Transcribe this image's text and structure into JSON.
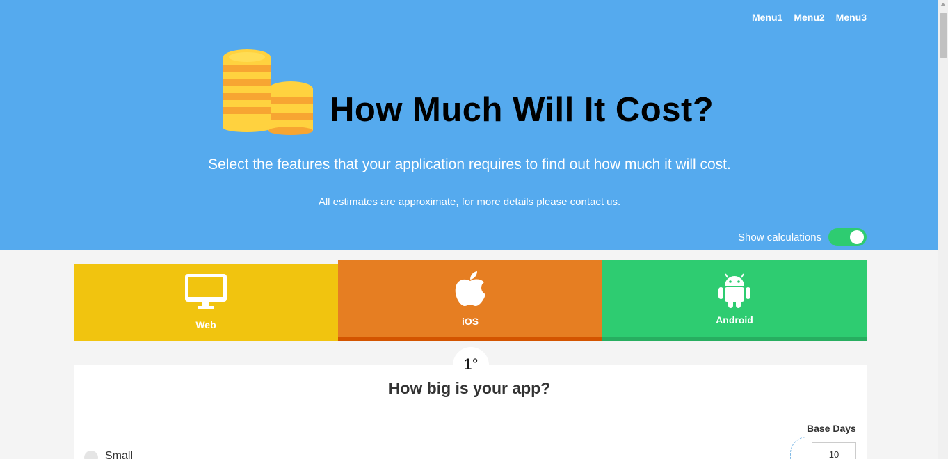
{
  "nav": {
    "items": [
      "Menu1",
      "Menu2",
      "Menu3"
    ]
  },
  "hero": {
    "title": "How Much Will It Cost?",
    "subtitle": "Select the features that your application requires to find out how much it will cost.",
    "note": "All estimates are approximate, for more details please contact us.",
    "illustration": "coins-stack-icon"
  },
  "toggle": {
    "label": "Show calculations",
    "state": "on",
    "color": "#2ecc71"
  },
  "platforms": [
    {
      "label": "Web",
      "icon": "monitor-icon",
      "color": "#f1c40f"
    },
    {
      "label": "iOS",
      "icon": "apple-icon",
      "color": "#e67e22"
    },
    {
      "label": "Android",
      "icon": "android-icon",
      "color": "#2ecc71"
    }
  ],
  "step": {
    "number": "1°",
    "question": "How big is your app?",
    "base_days_label": "Base Days",
    "base_days_value": "10",
    "options": [
      {
        "label": "Small"
      }
    ]
  },
  "colors": {
    "hero_bg": "#55aaee",
    "page_bg": "#f4f4f4"
  }
}
